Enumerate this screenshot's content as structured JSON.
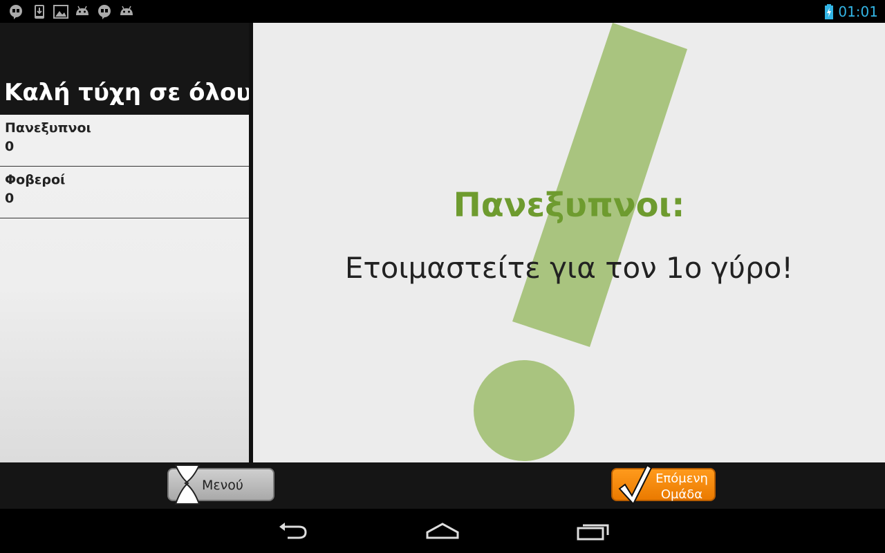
{
  "status_bar": {
    "time": "01:01",
    "notification_icons": [
      "hangouts-icon",
      "download-icon",
      "gallery-icon",
      "android-icon",
      "hangouts-icon",
      "android-icon"
    ],
    "accent_color": "#33b5e5"
  },
  "sidebar": {
    "title": "Καλή τύχη σε όλους!",
    "teams": [
      {
        "name": "Πανεξυπνοι",
        "score": "0"
      },
      {
        "name": "Φοβεροί",
        "score": "0"
      }
    ]
  },
  "main": {
    "current_team": "Πανεξυπνοι:",
    "message": "Ετοιμαστείτε για τον 1ο γύρο!",
    "team_color": "#6e9b2f",
    "decoration_color": "#a9c47f"
  },
  "actions": {
    "menu_label": "Μενού",
    "next_label_line1": "Επόμενη",
    "next_label_line2": "Ομάδα",
    "next_color": "#f68a0a"
  },
  "nav_bar": {
    "icons": [
      "back-icon",
      "home-icon",
      "recent-apps-icon"
    ]
  }
}
